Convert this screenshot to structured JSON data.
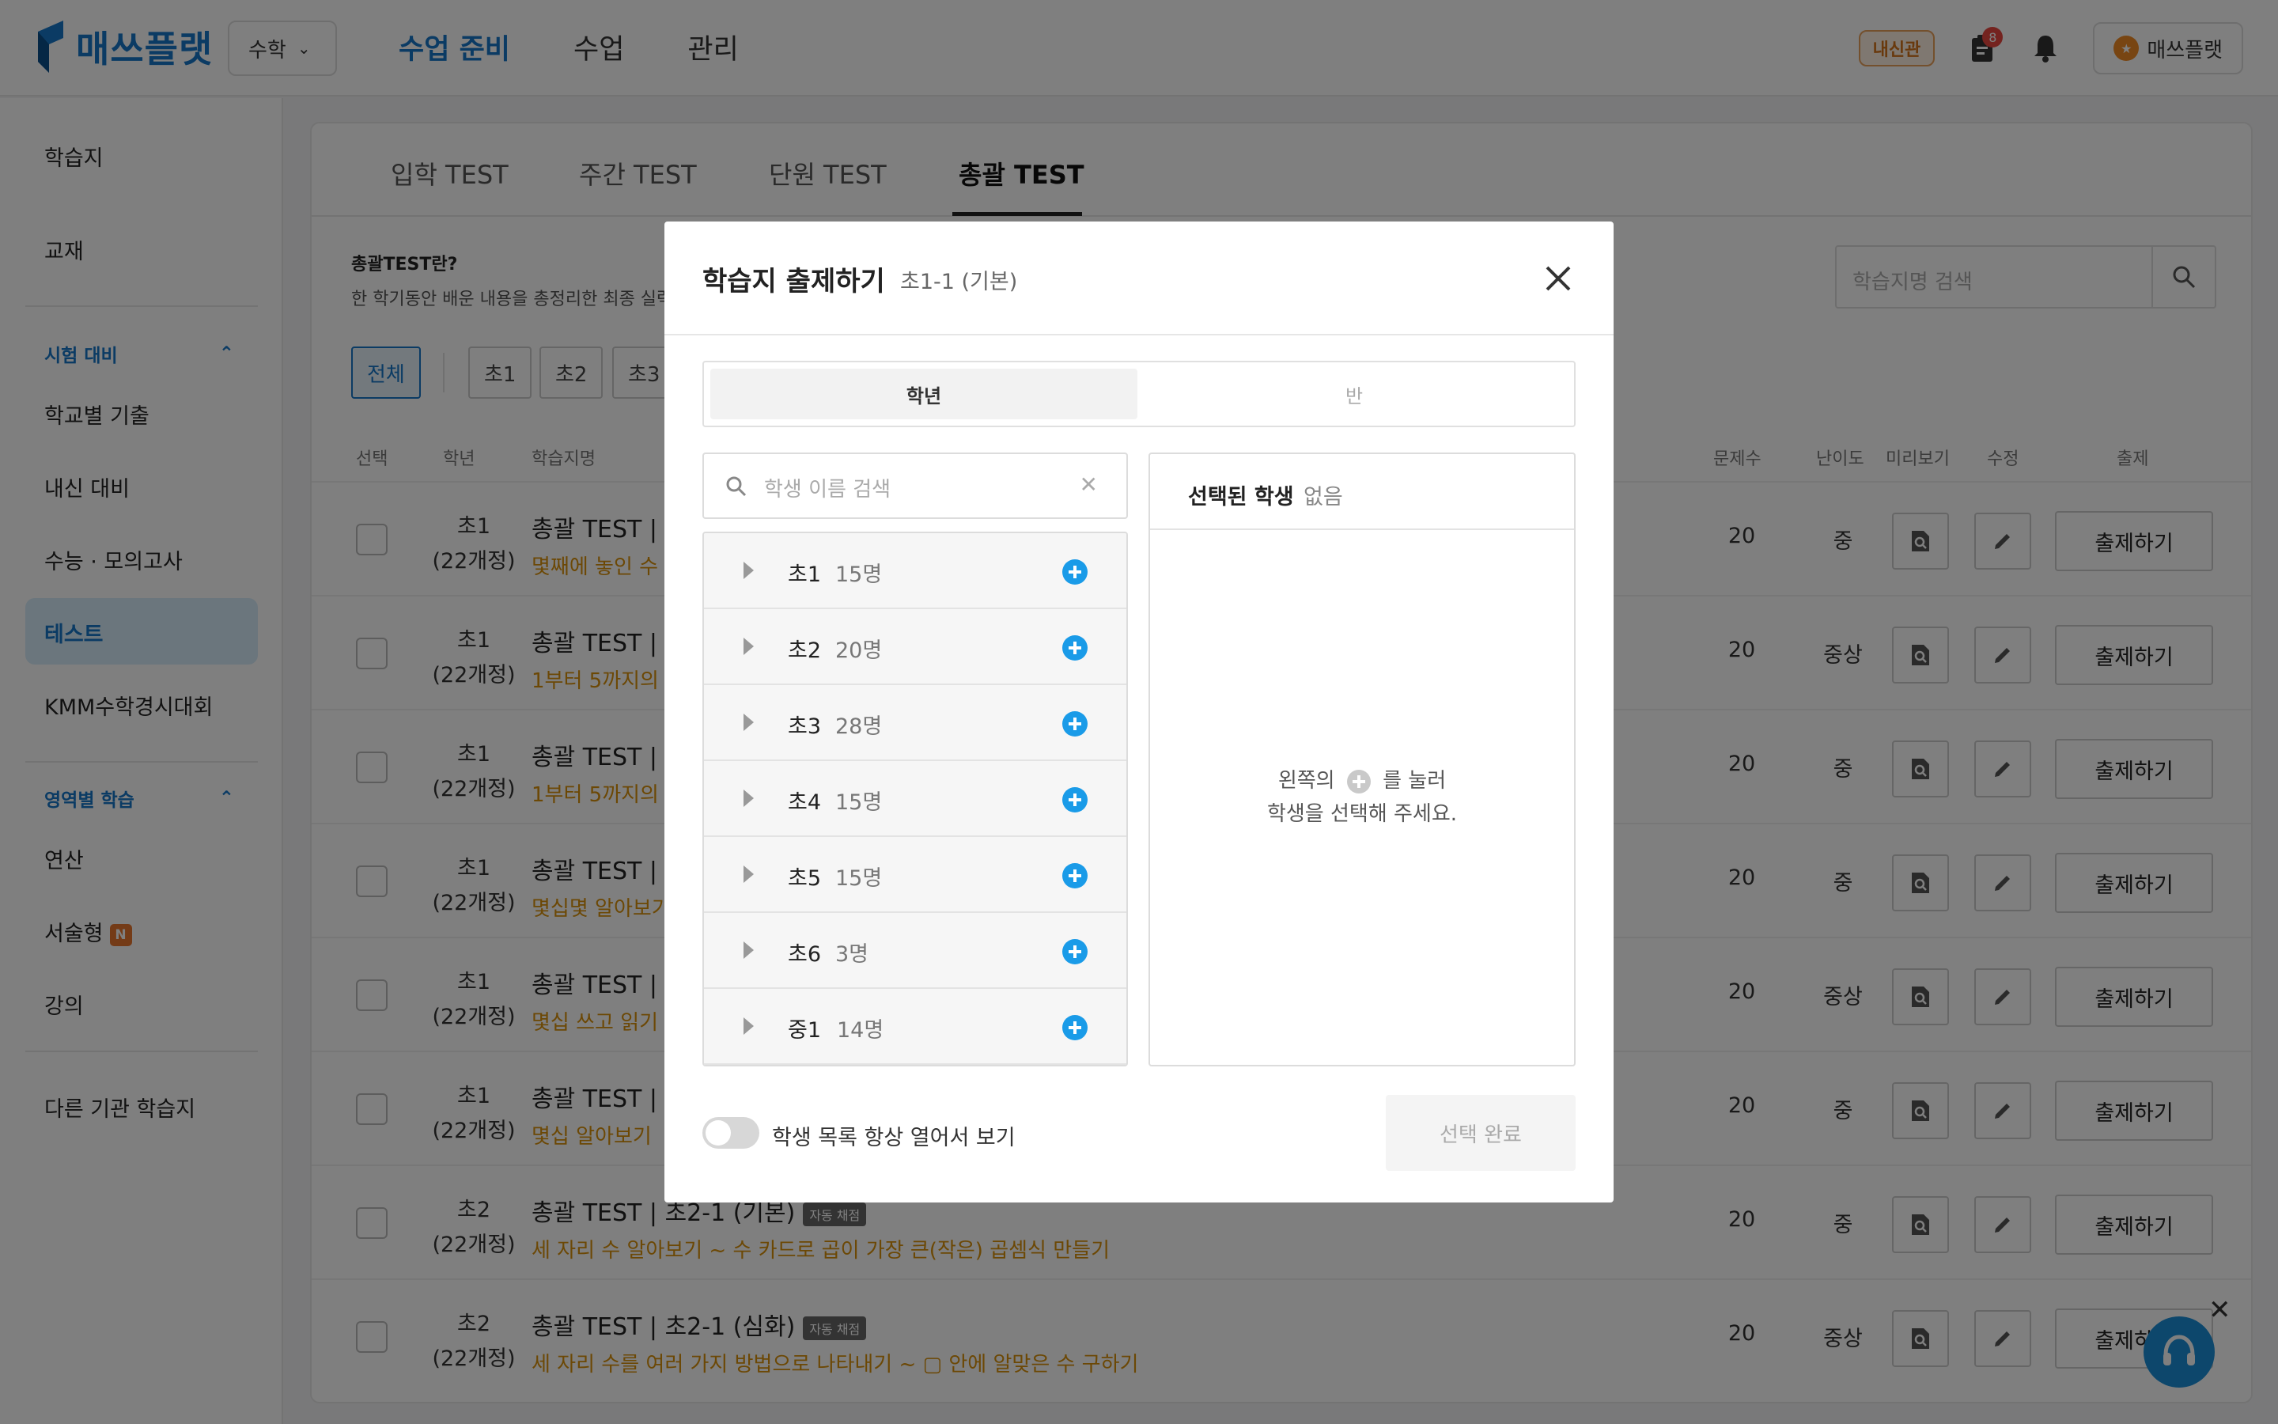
{
  "header": {
    "logo": "매쓰플랫",
    "subject": "수학",
    "nav": [
      "수업 준비",
      "수업",
      "관리"
    ],
    "naesin_label": "내신관",
    "notification_count": "8",
    "profile_name": "매쓰플랫"
  },
  "sidebar": {
    "item_worksheet": "학습지",
    "item_textbook": "교재",
    "section_exam": "시험 대비",
    "item_school_past": "학교별 기출",
    "item_naesin": "내신 대비",
    "item_suneung": "수능 · 모의고사",
    "item_test": "테스트",
    "item_kmm": "KMM수학경시대회",
    "section_area": "영역별 학습",
    "item_calc": "연산",
    "item_essay": "서술형",
    "new_badge": "N",
    "item_lecture": "강의",
    "item_other": "다른 기관 학습지"
  },
  "main": {
    "tabs": [
      "입학 TEST",
      "주간 TEST",
      "단원 TEST",
      "총괄 TEST"
    ],
    "info_title": "총괄TEST란?",
    "info_desc": "한 학기동안 배운 내용을 총정리한 최종 실력",
    "search_placeholder": "학습지명 검색",
    "chips": [
      "전체",
      "초1",
      "초2",
      "초3"
    ],
    "columns": {
      "select": "선택",
      "grade": "학년",
      "name": "학습지명",
      "count": "문제수",
      "difficulty": "난이도",
      "preview": "미리보기",
      "edit": "수정",
      "assign": "출제"
    },
    "assign_label": "출제하기",
    "auto_label": "자동 채점",
    "rows": [
      {
        "grade": "초1",
        "curr": "(22개정)",
        "title": "총괄 TEST | ",
        "sub": "몇째에 놓인 수 ",
        "count": "20",
        "diff": "중"
      },
      {
        "grade": "초1",
        "curr": "(22개정)",
        "title": "총괄 TEST | ",
        "sub": "1부터 5까지의 ",
        "count": "20",
        "diff": "중상"
      },
      {
        "grade": "초1",
        "curr": "(22개정)",
        "title": "총괄 TEST | ",
        "sub": "1부터 5까지의 ",
        "count": "20",
        "diff": "중"
      },
      {
        "grade": "초1",
        "curr": "(22개정)",
        "title": "총괄 TEST | ",
        "sub": "몇십몇 알아보기 ",
        "count": "20",
        "diff": "중"
      },
      {
        "grade": "초1",
        "curr": "(22개정)",
        "title": "총괄 TEST | ",
        "sub": "몇십 쓰고 읽기 ",
        "count": "20",
        "diff": "중상"
      },
      {
        "grade": "초1",
        "curr": "(22개정)",
        "title": "총괄 TEST | ",
        "sub": "몇십 알아보기 ",
        "count": "20",
        "diff": "중"
      },
      {
        "grade": "초2",
        "curr": "(22개정)",
        "title": "총괄 TEST | 초2-1 (기본)",
        "sub": "세 자리 수 알아보기 ~ 수 카드로 곱이 가장 큰(작은) 곱셈식 만들기",
        "count": "20",
        "diff": "중"
      },
      {
        "grade": "초2",
        "curr": "(22개정)",
        "title": "총괄 TEST | 초2-1 (심화)",
        "sub": "세 자리 수를 여러 가지 방법으로 나타내기 ~ ▢ 안에 알맞은 수 구하기",
        "count": "20",
        "diff": "중상"
      }
    ]
  },
  "modal": {
    "title": "학습지 출제하기",
    "subtitle": "초1-1 (기본)",
    "seg_grade": "학년",
    "seg_class": "반",
    "search_placeholder": "학생 이름 검색",
    "grades": [
      {
        "name": "초1",
        "count": "15명"
      },
      {
        "name": "초2",
        "count": "20명"
      },
      {
        "name": "초3",
        "count": "28명"
      },
      {
        "name": "초4",
        "count": "15명"
      },
      {
        "name": "초5",
        "count": "15명"
      },
      {
        "name": "초6",
        "count": "3명"
      },
      {
        "name": "중1",
        "count": "14명"
      }
    ],
    "selected_title": "선택된 학생",
    "selected_value": "없음",
    "empty_line1_pre": "왼쪽의",
    "empty_line1_post": "를 눌러",
    "empty_line2": "학생을 선택해 주세요.",
    "toggle_label": "학생 목록 항상 열어서 보기",
    "toggle_on": false,
    "done_label": "선택 완료"
  },
  "colors": {
    "accent": "#1677c8",
    "add_icon": "#1a9be8",
    "subtitle_orange": "#d9900a"
  }
}
